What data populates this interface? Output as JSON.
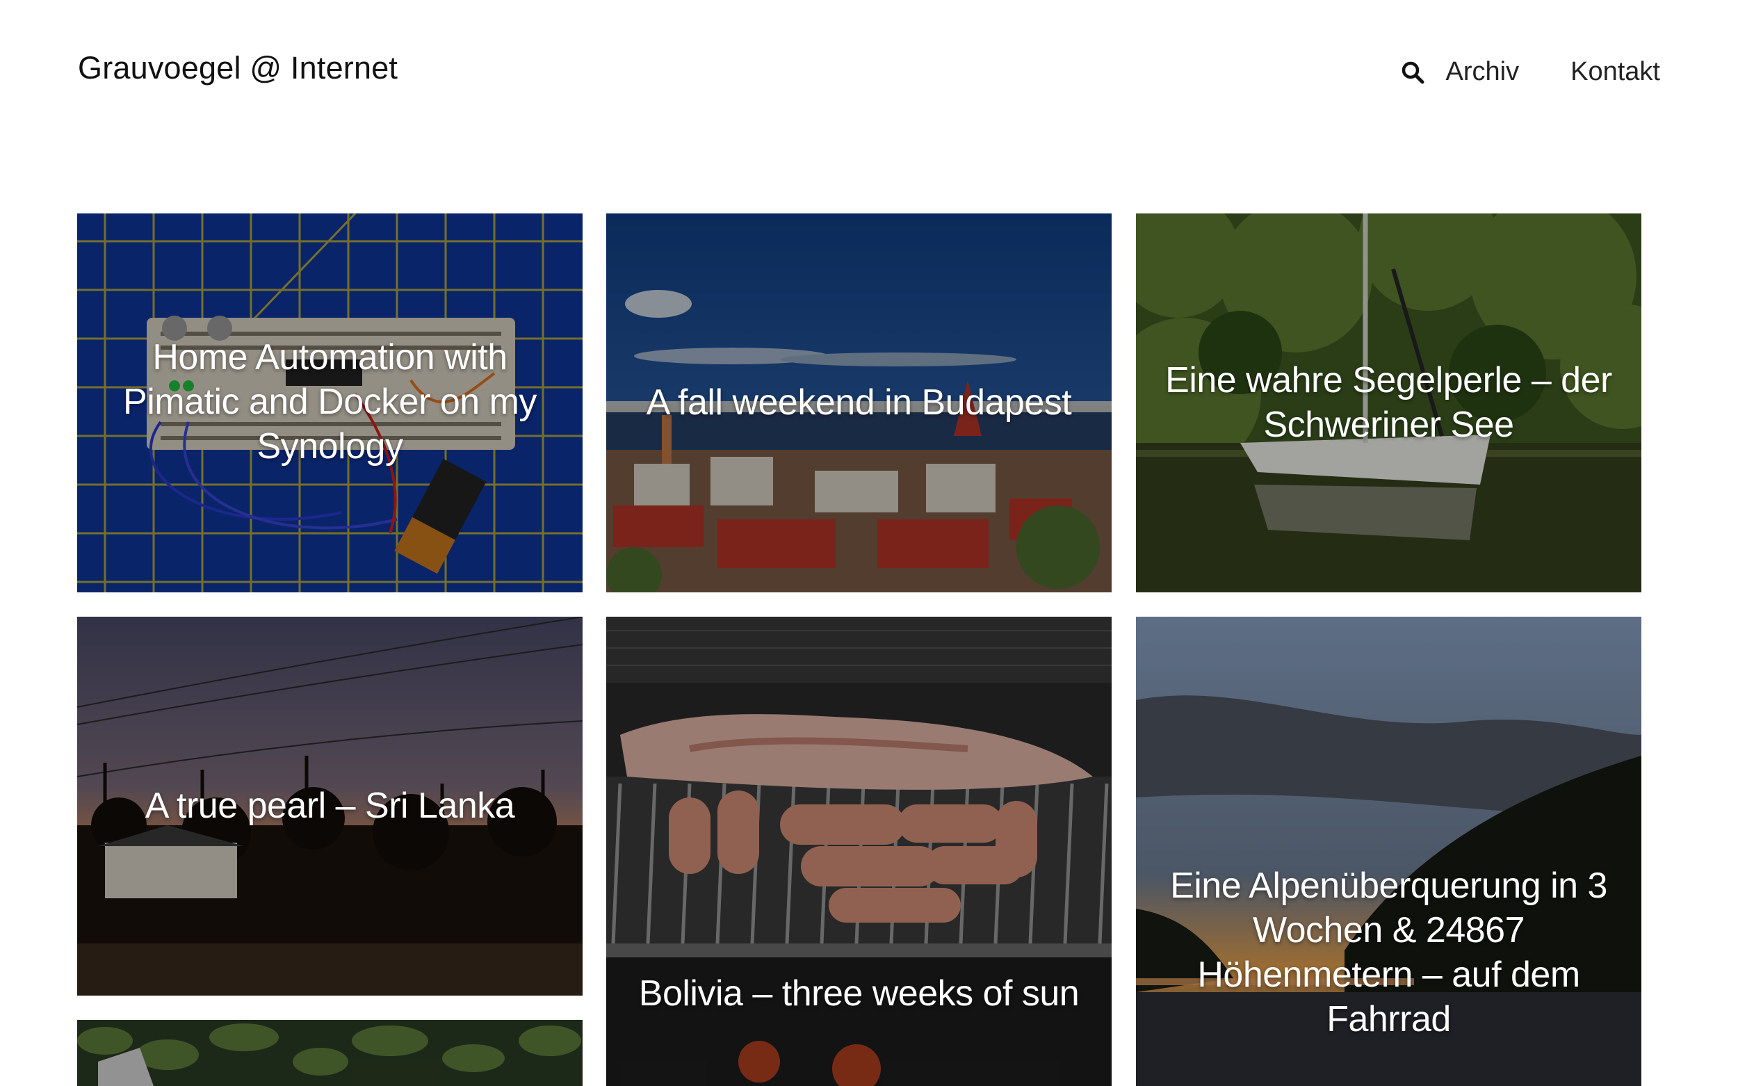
{
  "header": {
    "site_title": "Grauvoegel @ Internet",
    "nav": [
      {
        "label": "Archiv"
      },
      {
        "label": "Kontakt"
      }
    ]
  },
  "posts": [
    {
      "title": "Home Automation with Pimatic and Docker on my Synology"
    },
    {
      "title": "A fall weekend in Budapest"
    },
    {
      "title": "Eine wahre Segelperle – der Schweriner See"
    },
    {
      "title": "A true pearl – Sri Lanka"
    },
    {
      "title": "Bolivia – three weeks of sun"
    },
    {
      "title": "Eine Alpenüberquerung in 3 Wochen & 24867 Höhenmetern – auf dem Fahrrad"
    },
    {
      "title": ""
    }
  ]
}
